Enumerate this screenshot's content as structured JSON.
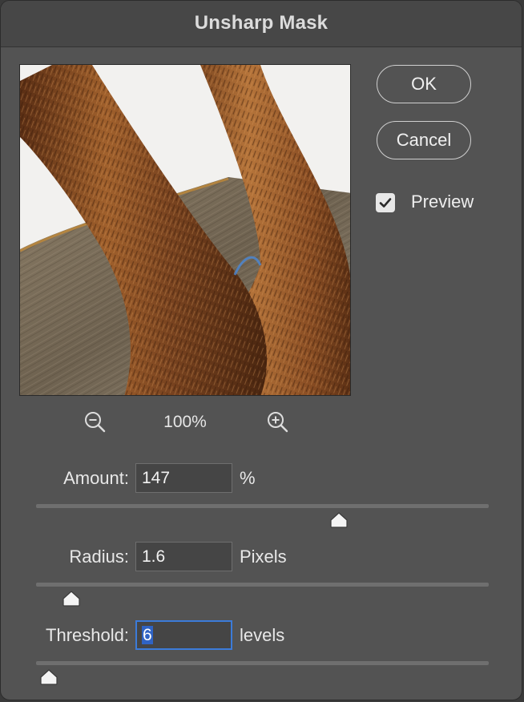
{
  "dialog": {
    "title": "Unsharp Mask"
  },
  "buttons": {
    "ok_label": "OK",
    "cancel_label": "Cancel"
  },
  "preview_toggle": {
    "label": "Preview",
    "checked": true
  },
  "zoom": {
    "level": "100%",
    "zoom_out_icon": "zoom-out-icon",
    "zoom_in_icon": "zoom-in-icon"
  },
  "controls": {
    "amount": {
      "label": "Amount:",
      "value": "147",
      "unit": "%",
      "min": 1,
      "max": 500
    },
    "radius": {
      "label": "Radius:",
      "value": "1.6",
      "unit": "Pixels"
    },
    "threshold": {
      "label": "Threshold:",
      "value": "6",
      "unit": "levels",
      "min": 0,
      "max": 255
    }
  },
  "colors": {
    "dialog_bg": "#535353",
    "accent": "#3c7bd9",
    "selection": "#2f63c4"
  }
}
